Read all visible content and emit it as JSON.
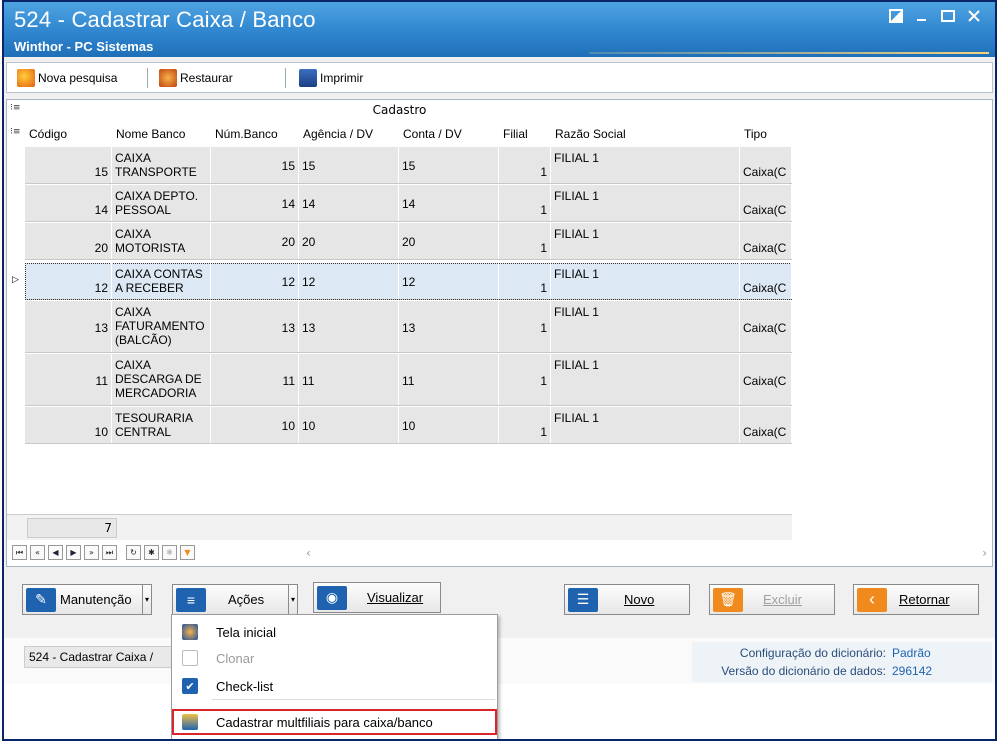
{
  "window": {
    "title": "524 - Cadastrar Caixa / Banco",
    "subtitle": "Winthor - PC Sistemas",
    "controls": [
      "restore-icon",
      "minimize-icon",
      "maximize-icon",
      "close-icon"
    ]
  },
  "toolbar": {
    "nova_pesquisa": "Nova pesquisa",
    "restaurar": "Restaurar",
    "imprimir": "Imprimir"
  },
  "grid": {
    "band_title": "Cadastro",
    "columns": [
      "Código",
      "Nome Banco",
      "Núm.Banco",
      "Agência / DV",
      "Conta / DV",
      "Filial",
      "Razão Social",
      "Tipo"
    ],
    "rows": [
      {
        "codigo": "15",
        "nome": "CAIXA TRANSPORTE",
        "num": "15",
        "agencia": "15",
        "conta": "15",
        "filial": "1",
        "razao": "FILIAL 1",
        "tipo": "Caixa(C"
      },
      {
        "codigo": "14",
        "nome": "CAIXA DEPTO. PESSOAL",
        "num": "14",
        "agencia": "14",
        "conta": "14",
        "filial": "1",
        "razao": "FILIAL 1",
        "tipo": "Caixa(C"
      },
      {
        "codigo": "20",
        "nome": "CAIXA MOTORISTA",
        "num": "20",
        "agencia": "20",
        "conta": "20",
        "filial": "1",
        "razao": "FILIAL 1",
        "tipo": "Caixa(C"
      },
      {
        "codigo": "12",
        "nome": "CAIXA CONTAS A RECEBER",
        "num": "12",
        "agencia": "12",
        "conta": "12",
        "filial": "1",
        "razao": "FILIAL 1",
        "tipo": "Caixa(C"
      },
      {
        "codigo": "13",
        "nome": "CAIXA FATURAMENTO (BALCÃO)",
        "num": "13",
        "agencia": "13",
        "conta": "13",
        "filial": "1",
        "razao": "FILIAL 1",
        "tipo": "Caixa(C"
      },
      {
        "codigo": "11",
        "nome": "CAIXA DESCARGA DE MERCADORIA",
        "num": "11",
        "agencia": "11",
        "conta": "11",
        "filial": "1",
        "razao": "FILIAL 1",
        "tipo": "Caixa(C"
      },
      {
        "codigo": "10",
        "nome": "TESOURARIA CENTRAL",
        "num": "10",
        "agencia": "10",
        "conta": "10",
        "filial": "1",
        "razao": "FILIAL 1",
        "tipo": "Caixa(C"
      }
    ],
    "selected_row": 3,
    "record_count": "7"
  },
  "navigator": [
    "first-icon",
    "prev-page-icon",
    "prev-icon",
    "next-icon",
    "next-page-icon",
    "last-icon",
    "refresh-icon",
    "insert-icon",
    "delete-icon",
    "filter-icon"
  ],
  "actions": {
    "manutencao": "Manutenção",
    "acoes": "Ações",
    "visualizar": "Visualizar",
    "novo": "Novo",
    "excluir": "Excluir",
    "retornar": "Retornar"
  },
  "menu": {
    "items": [
      {
        "label": "Tela inicial",
        "enabled": true
      },
      {
        "label": "Clonar",
        "enabled": false
      },
      {
        "label": "Check-list",
        "enabled": true
      },
      {
        "label": "Cadastrar multfiliais para caixa/banco",
        "enabled": true,
        "highlighted": true
      }
    ]
  },
  "status": {
    "left": "524 - Cadastrar Caixa /",
    "config_label": "Configuração do dicionário:",
    "config_value": "Padrão",
    "versao_label": "Versão do dicionário de dados:",
    "versao_value": "296142"
  },
  "colors": {
    "title_bar": "#2f86cf",
    "selected_row": "#dce8f4",
    "menu_highlight": "#d9262c",
    "novo_icon": "#1f63b0",
    "excluir_icon": "#f08a1c",
    "retornar_icon": "#f08a1c"
  }
}
